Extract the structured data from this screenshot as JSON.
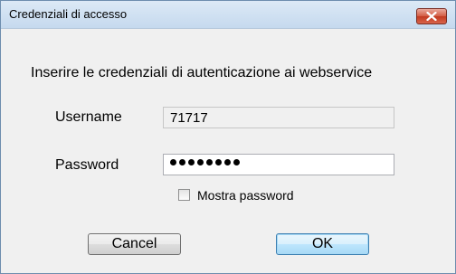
{
  "window": {
    "title": "Credenziali di accesso"
  },
  "form": {
    "prompt": "Inserire le credenziali di autenticazione ai webservice",
    "username_label": "Username",
    "username_value": "71717",
    "password_label": "Password",
    "password_masked_length": 8,
    "show_password_label": "Mostra password",
    "show_password_checked": false
  },
  "buttons": {
    "cancel_label": "Cancel",
    "ok_label": "OK"
  },
  "colors": {
    "close_button": "#c7472f",
    "default_button_border": "#3c7fb1",
    "dialog_background": "#f0f0f0"
  },
  "icons": {
    "close": "close-icon",
    "checkbox": "checkbox-icon"
  }
}
